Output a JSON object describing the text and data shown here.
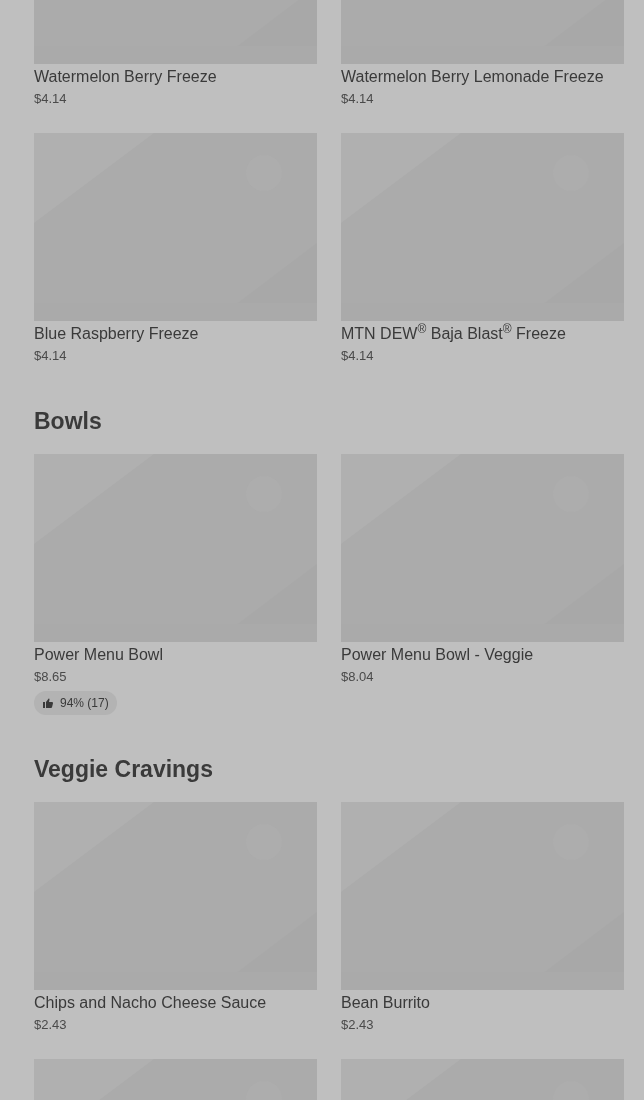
{
  "sections": [
    {
      "items": [
        {
          "kind": "product",
          "name": "Watermelon Berry Freeze",
          "price": "$4.14"
        },
        {
          "kind": "product",
          "name": "Watermelon Berry Lemonade Freeze",
          "price": "$4.14"
        },
        {
          "kind": "product",
          "name": "Blue Raspberry Freeze",
          "price": "$4.14"
        },
        {
          "kind": "product",
          "name": "MTN DEW$^{®}$ Baja Blast$^{®}$ Freeze",
          "price": "$4.14"
        }
      ]
    },
    {
      "title": "Bowls",
      "items": [
        {
          "kind": "product",
          "name": "Power Menu Bowl",
          "price": "$8.65",
          "rating": "94% (17)"
        },
        {
          "kind": "product",
          "name": "Power Menu Bowl - Veggie",
          "price": "$8.04"
        }
      ]
    },
    {
      "title": "Veggie Cravings",
      "items": [
        {
          "kind": "product",
          "name": "Chips and Nacho Cheese Sauce",
          "price": "$2.43"
        },
        {
          "kind": "product",
          "name": "Bean Burrito",
          "price": "$2.43"
        },
        {
          "kind": "picture"
        },
        {
          "kind": "picture"
        }
      ]
    }
  ]
}
